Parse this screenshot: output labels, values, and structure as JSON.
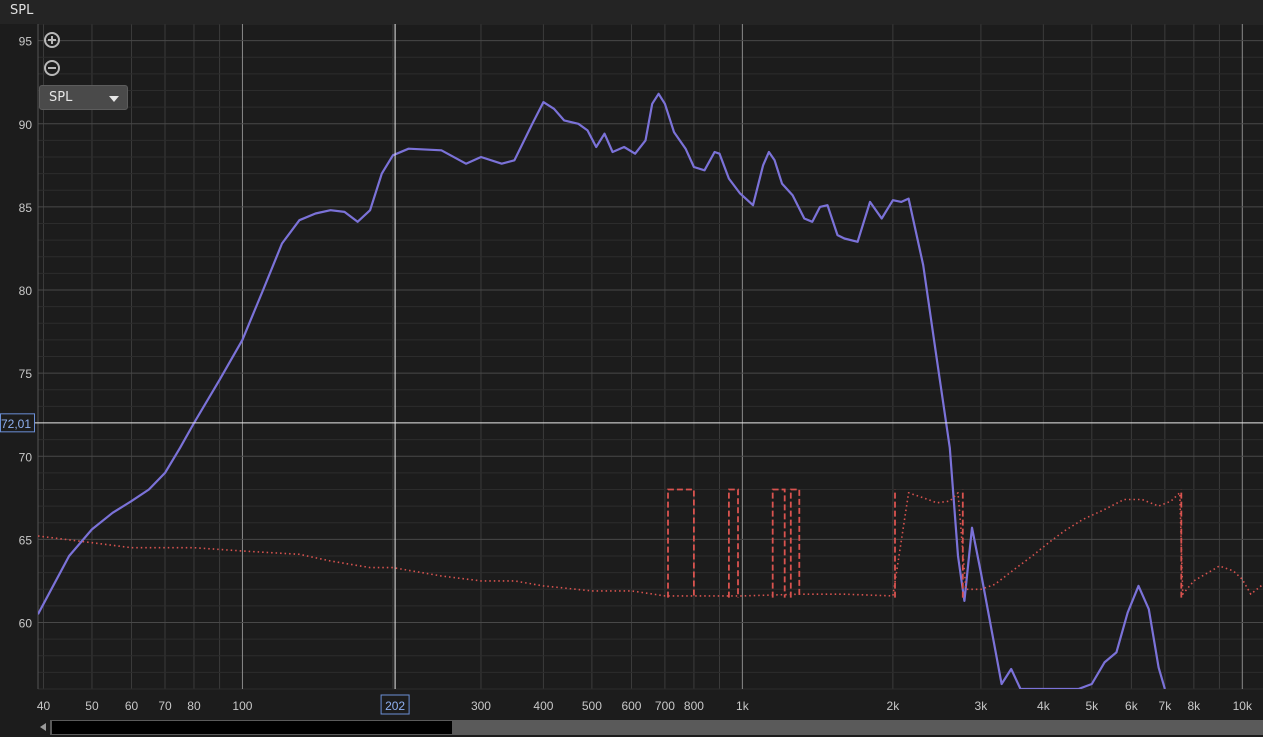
{
  "header": {
    "title": "SPL"
  },
  "controls": {
    "zoom_in_icon": "zoom-in-icon",
    "zoom_out_icon": "zoom-out-icon",
    "select_value": "SPL"
  },
  "cursor": {
    "y_readout": "72,01",
    "x_readout": "202",
    "x_value": 202,
    "y_value": 72.01
  },
  "chart_data": {
    "type": "line",
    "xscale": "log",
    "xlim": [
      39,
      11000
    ],
    "ylim": [
      56,
      96
    ],
    "y_ticks": [
      60,
      65,
      70,
      75,
      80,
      85,
      90,
      95
    ],
    "x_ticks": [
      {
        "v": 40,
        "label": "40"
      },
      {
        "v": 50,
        "label": "50"
      },
      {
        "v": 60,
        "label": "60"
      },
      {
        "v": 70,
        "label": "70"
      },
      {
        "v": 80,
        "label": "80"
      },
      {
        "v": 100,
        "label": "100"
      },
      {
        "v": 300,
        "label": "300"
      },
      {
        "v": 400,
        "label": "400"
      },
      {
        "v": 500,
        "label": "500"
      },
      {
        "v": 600,
        "label": "600"
      },
      {
        "v": 700,
        "label": "700"
      },
      {
        "v": 800,
        "label": "800"
      },
      {
        "v": 1000,
        "label": "1k"
      },
      {
        "v": 2000,
        "label": "2k"
      },
      {
        "v": 3000,
        "label": "3k"
      },
      {
        "v": 4000,
        "label": "4k"
      },
      {
        "v": 5000,
        "label": "5k"
      },
      {
        "v": 6000,
        "label": "6k"
      },
      {
        "v": 7000,
        "label": "7k"
      },
      {
        "v": 8000,
        "label": "8k"
      },
      {
        "v": 10000,
        "label": "10k"
      }
    ],
    "grid": true,
    "colors": {
      "spl": "#7b72d8",
      "secondary": "#d9534f",
      "grid": "#3a3a3a",
      "cursor": "#e8e8e8",
      "bg": "#1c1c1c"
    },
    "series": [
      {
        "style": "solid",
        "points": [
          [
            39,
            60.5
          ],
          [
            45,
            64
          ],
          [
            50,
            65.6
          ],
          [
            55,
            66.6
          ],
          [
            60,
            67.3
          ],
          [
            65,
            68
          ],
          [
            70,
            69
          ],
          [
            75,
            70.5
          ],
          [
            80,
            72
          ],
          [
            90,
            74.6
          ],
          [
            100,
            77
          ],
          [
            110,
            80
          ],
          [
            120,
            82.8
          ],
          [
            130,
            84.2
          ],
          [
            140,
            84.6
          ],
          [
            150,
            84.8
          ],
          [
            160,
            84.7
          ],
          [
            170,
            84.1
          ],
          [
            180,
            84.8
          ],
          [
            190,
            87
          ],
          [
            200,
            88.1
          ],
          [
            215,
            88.5
          ],
          [
            250,
            88.4
          ],
          [
            280,
            87.6
          ],
          [
            300,
            88
          ],
          [
            330,
            87.6
          ],
          [
            350,
            87.8
          ],
          [
            380,
            90
          ],
          [
            400,
            91.3
          ],
          [
            420,
            90.9
          ],
          [
            440,
            90.2
          ],
          [
            470,
            90
          ],
          [
            490,
            89.6
          ],
          [
            510,
            88.6
          ],
          [
            530,
            89.4
          ],
          [
            550,
            88.3
          ],
          [
            580,
            88.6
          ],
          [
            610,
            88.2
          ],
          [
            640,
            89
          ],
          [
            660,
            91.2
          ],
          [
            680,
            91.8
          ],
          [
            700,
            91.2
          ],
          [
            730,
            89.5
          ],
          [
            770,
            88.5
          ],
          [
            800,
            87.4
          ],
          [
            840,
            87.2
          ],
          [
            880,
            88.3
          ],
          [
            900,
            88.2
          ],
          [
            940,
            86.7
          ],
          [
            990,
            85.8
          ],
          [
            1050,
            85.1
          ],
          [
            1100,
            87.5
          ],
          [
            1130,
            88.3
          ],
          [
            1160,
            87.8
          ],
          [
            1200,
            86.4
          ],
          [
            1260,
            85.7
          ],
          [
            1330,
            84.3
          ],
          [
            1380,
            84.1
          ],
          [
            1430,
            85
          ],
          [
            1480,
            85.1
          ],
          [
            1550,
            83.3
          ],
          [
            1600,
            83.1
          ],
          [
            1700,
            82.9
          ],
          [
            1800,
            85.3
          ],
          [
            1900,
            84.3
          ],
          [
            2000,
            85.4
          ],
          [
            2080,
            85.3
          ],
          [
            2150,
            85.5
          ],
          [
            2300,
            81.5
          ],
          [
            2450,
            75.8
          ],
          [
            2600,
            70.5
          ],
          [
            2700,
            64
          ],
          [
            2780,
            61.3
          ],
          [
            2880,
            65.7
          ],
          [
            3000,
            63
          ],
          [
            3300,
            56.3
          ],
          [
            3450,
            57.2
          ],
          [
            3600,
            56
          ],
          [
            4700,
            56
          ],
          [
            5000,
            56.3
          ],
          [
            5300,
            57.6
          ],
          [
            5600,
            58.2
          ],
          [
            5900,
            60.6
          ],
          [
            6200,
            62.2
          ],
          [
            6500,
            60.8
          ],
          [
            6800,
            57.3
          ],
          [
            7000,
            56
          ]
        ]
      },
      {
        "style": "dotted",
        "points": [
          [
            39,
            65.2
          ],
          [
            50,
            64.8
          ],
          [
            60,
            64.5
          ],
          [
            80,
            64.5
          ],
          [
            100,
            64.3
          ],
          [
            130,
            64.1
          ],
          [
            150,
            63.7
          ],
          [
            180,
            63.3
          ],
          [
            200,
            63.3
          ],
          [
            250,
            62.8
          ],
          [
            300,
            62.5
          ],
          [
            350,
            62.5
          ],
          [
            400,
            62.2
          ],
          [
            500,
            61.9
          ],
          [
            600,
            61.9
          ],
          [
            700,
            61.6
          ],
          [
            800,
            61.6
          ],
          [
            1000,
            61.6
          ],
          [
            1300,
            61.7
          ],
          [
            1600,
            61.7
          ],
          [
            2000,
            61.6
          ],
          [
            2150,
            67.8
          ],
          [
            2300,
            67.5
          ],
          [
            2450,
            67.2
          ],
          [
            2600,
            67.3
          ],
          [
            2700,
            67.8
          ],
          [
            2800,
            62
          ],
          [
            3000,
            62
          ],
          [
            3200,
            62.3
          ],
          [
            3500,
            63.2
          ],
          [
            3800,
            64
          ],
          [
            4100,
            64.8
          ],
          [
            4400,
            65.5
          ],
          [
            4800,
            66.2
          ],
          [
            5300,
            66.8
          ],
          [
            5800,
            67.4
          ],
          [
            6300,
            67.4
          ],
          [
            6800,
            67
          ],
          [
            7200,
            67.3
          ],
          [
            7500,
            67.8
          ],
          [
            7600,
            61.7
          ],
          [
            8000,
            62.5
          ],
          [
            9000,
            63.4
          ],
          [
            9600,
            63.1
          ],
          [
            10000,
            62.6
          ],
          [
            10400,
            61.7
          ],
          [
            11000,
            62.3
          ]
        ]
      },
      {
        "style": "dashed",
        "segments": [
          [
            [
              710,
              61.5
            ],
            [
              710,
              68
            ],
            [
              800,
              68
            ],
            [
              800,
              61.5
            ]
          ],
          [
            [
              940,
              61.5
            ],
            [
              940,
              68
            ],
            [
              980,
              68
            ],
            [
              980,
              61.5
            ]
          ],
          [
            [
              1150,
              61.5
            ],
            [
              1150,
              68
            ],
            [
              1215,
              68
            ],
            [
              1215,
              61.5
            ]
          ],
          [
            [
              1250,
              61.5
            ],
            [
              1250,
              68
            ],
            [
              1300,
              68
            ],
            [
              1300,
              61.5
            ]
          ],
          [
            [
              2020,
              61.5
            ],
            [
              2020,
              68
            ]
          ],
          [
            [
              2760,
              61.5
            ],
            [
              2760,
              68
            ]
          ],
          [
            [
              7550,
              61.5
            ],
            [
              7550,
              68
            ]
          ]
        ]
      }
    ]
  }
}
